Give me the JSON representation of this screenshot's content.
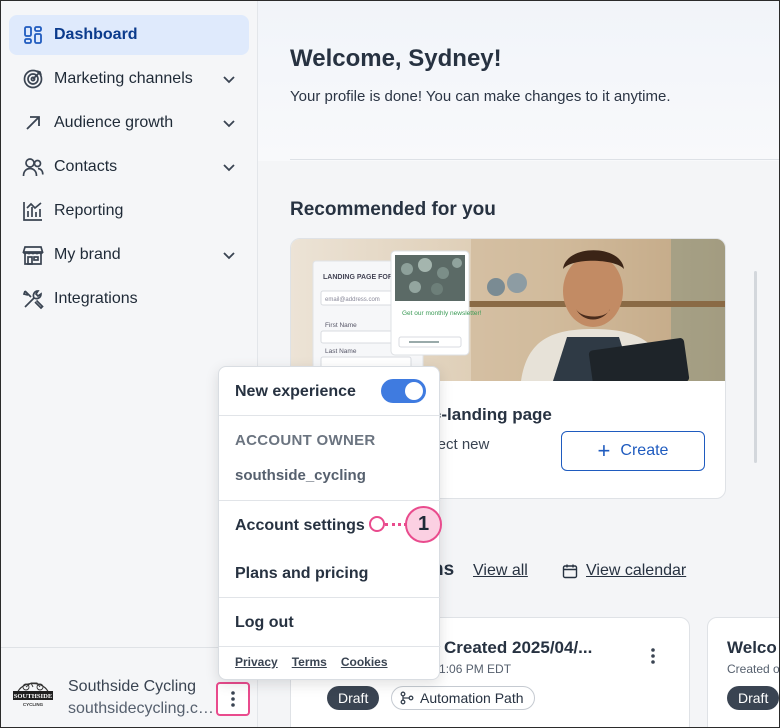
{
  "sidebar": {
    "items": [
      {
        "label": "Dashboard",
        "icon": "dashboard-icon",
        "active": true
      },
      {
        "label": "Marketing channels",
        "icon": "target-icon",
        "expandable": true
      },
      {
        "label": "Audience growth",
        "icon": "arrow-up-right-icon",
        "expandable": true
      },
      {
        "label": "Contacts",
        "icon": "people-icon",
        "expandable": true
      },
      {
        "label": "Reporting",
        "icon": "bar-chart-icon"
      },
      {
        "label": "My brand",
        "icon": "storefront-icon",
        "expandable": true
      },
      {
        "label": "Integrations",
        "icon": "tools-icon"
      }
    ],
    "account": {
      "name": "Southside Cycling",
      "email": "southsidecycling.com",
      "logo_text": "SOUTHSIDE CYCLING"
    }
  },
  "main": {
    "welcome_title": "Welcome, Sydney!",
    "welcome_subtitle": "Your profile is done! You can make changes to it anytime.",
    "recommended_title": "Recommended for you",
    "rec_card": {
      "title_partial": "o-landing page",
      "desc_partial": "llect new",
      "create_label": "Create",
      "image_form_title": "LANDING PAGE FORM",
      "image_field_email": "email@address.com",
      "image_field_first": "First Name",
      "image_field_last": "Last Name",
      "image_popup_text": "Get our monthly newsletter!"
    },
    "section2": {
      "title_partial": "ns",
      "view_all": "View all",
      "view_calendar": "View calendar"
    },
    "campaigns": [
      {
        "title": "ries Created 2025/04/...",
        "meta": "25 at 1:06 PM EDT",
        "status": "Draft",
        "type": "Automation Path"
      },
      {
        "title": "Welco",
        "meta": "Created o",
        "status": "Draft"
      }
    ]
  },
  "menu": {
    "new_experience": "New experience",
    "toggle_on": true,
    "owner_label": "ACCOUNT OWNER",
    "owner_user": "southside_cycling",
    "account_settings": "Account settings",
    "plans_pricing": "Plans and pricing",
    "logout": "Log out",
    "links": [
      "Privacy",
      "Terms",
      "Cookies"
    ]
  },
  "callout": {
    "number": "1"
  },
  "colors": {
    "accent": "#3f7be0",
    "active_nav_bg": "#dfeafc",
    "callout_pink": "#e94b8d"
  }
}
